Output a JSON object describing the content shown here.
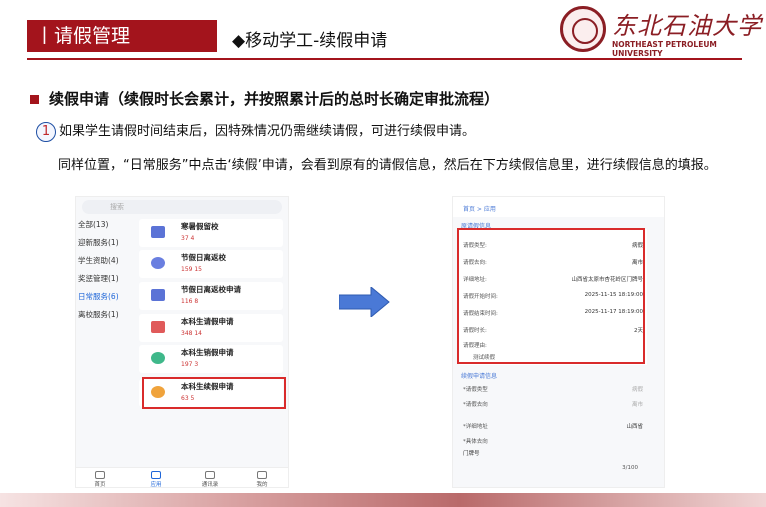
{
  "header": {
    "section_tag": "丨请假管理",
    "subtitle": "◆移动学工-续假申请",
    "logo_cn": "东北石油大学",
    "logo_en": "NORTHEAST PETROLEUM UNIVERSITY"
  },
  "content": {
    "heading": "续假申请（续假时长会累计，并按照累计后的总时长确定审批流程）",
    "step_number": "1",
    "paragraph1": "如果学生请假时间结束后，因特殊情况仍需继续请假，可进行续假申请。",
    "paragraph2": "同样位置，“日常服务”中点击‘续假’申请，会看到原有的请假信息，然后在下方续假信息里，进行续假信息的填报。"
  },
  "left_phone": {
    "search_placeholder": "搜索",
    "categories": [
      "全部(13)",
      "迎新服务(1)",
      "学生资助(4)",
      "奖惩管理(1)",
      "日常服务(6)",
      "离校服务(1)"
    ],
    "cards": [
      {
        "title": "寒暑假留校",
        "stats": "37   4"
      },
      {
        "title": "节假日离返校",
        "stats": "159   15"
      },
      {
        "title": "节假日离返校申请",
        "stats": "116   8"
      },
      {
        "title": "本科生请假申请",
        "stats": "348   14"
      },
      {
        "title": "本科生销假申请",
        "stats": "197   3"
      },
      {
        "title": "本科生续假申请",
        "stats": "63   5"
      }
    ],
    "nav": [
      "首页",
      "应用",
      "通讯录",
      "我的"
    ]
  },
  "right_phone": {
    "breadcrumb": "首页 > 应用",
    "section1_title": "原请假信息",
    "rows": [
      {
        "k": "请假类型:",
        "v": "病假"
      },
      {
        "k": "请假去向:",
        "v": "离市"
      },
      {
        "k": "详细地址:",
        "v": "山西省太原市杏花岭区门牌号"
      },
      {
        "k": "请假开始时间:",
        "v": "2025-11-15 18:19:00"
      },
      {
        "k": "请假结束时间:",
        "v": "2025-11-17 18:19:00"
      },
      {
        "k": "请假时长:",
        "v": "2天"
      },
      {
        "k": "请假理由:",
        "v": ""
      },
      {
        "k": "",
        "v": "测试续假"
      }
    ],
    "section2_title": "续假申请信息",
    "rows2": [
      {
        "k": "*请假类型",
        "v": "病假"
      },
      {
        "k": "*请假去向",
        "v": "离市"
      },
      {
        "k": "*详细地址",
        "v": "山西省"
      },
      {
        "k": "*具体去向",
        "v": ""
      },
      {
        "k": "门牌号",
        "v": ""
      }
    ],
    "counter": "3/100"
  },
  "colors": {
    "brand": "#a3141c",
    "highlight": "#d92b2b",
    "link": "#1f66d8"
  }
}
